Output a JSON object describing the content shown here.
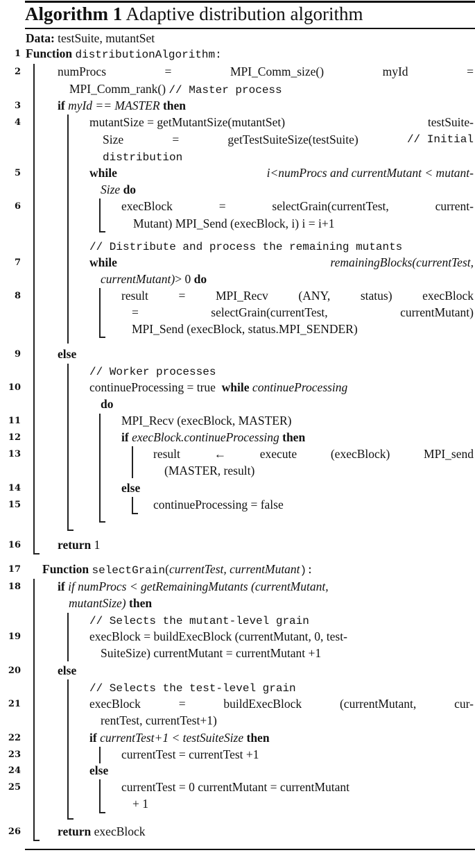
{
  "algorithm": {
    "label": "Algorithm 1",
    "caption": "Adaptive distribution algorithm",
    "data_label": "Data:",
    "data_value": "testSuite, mutantSet"
  },
  "lines": {
    "l1": {
      "num": "1",
      "kw": "Function",
      "name": "distributionAlgorithm",
      "colon": ":"
    },
    "l2": {
      "num": "2",
      "a": "numProcs",
      "b": "=",
      "c": "MPI_Comm_size()",
      "d": "myId",
      "e": "=",
      "cont": "MPI_Comm_rank()",
      "comment": "// Master process"
    },
    "l3": {
      "num": "3",
      "kw": "if",
      "cond": "myId == MASTER",
      "then": "then"
    },
    "l4": {
      "num": "4",
      "a": "mutantSize = getMutantSize(mutantSet)",
      "b": "testSuite-",
      "c": "Size",
      "d": "=",
      "e": "getTestSuiteSize(testSuite)",
      "comment": "// Initial",
      "comment2": "distribution"
    },
    "l5": {
      "num": "5",
      "kw": "while",
      "cond": "i<numProcs and currentMutant < mutant-",
      "cond2": "Size",
      "do": "do"
    },
    "l6": {
      "num": "6",
      "a": "execBlock",
      "b": "=",
      "c": "selectGrain(currentTest,",
      "d": "current-",
      "cont": "Mutant)  MPI_Send (execBlock, i)  i = i+1"
    },
    "c1": {
      "comment": "// Distribute and process the remaining mutants"
    },
    "l7": {
      "num": "7",
      "kw": "while",
      "cond": "remainingBlocks(currentTest,",
      "cond2": "currentMutant)",
      "gt": "> 0",
      "do": "do"
    },
    "l8": {
      "num": "8",
      "a": "result",
      "b": "=",
      "c": "MPI_Recv",
      "d": "(ANY,",
      "e": "status)",
      "f": "execBlock",
      "g": "=",
      "h": "selectGrain(currentTest,",
      "i": "currentMutant)",
      "cont": "MPI_Send (execBlock, status.MPI_SENDER)"
    },
    "l9": {
      "num": "9",
      "kw": "else"
    },
    "c2": {
      "comment": "// Worker processes"
    },
    "l10": {
      "num": "10",
      "a": "continueProcessing = true",
      "kw": "while",
      "cond": "continueProcessing",
      "do": "do"
    },
    "l11": {
      "num": "11",
      "text": "MPI_Recv (execBlock, MASTER)"
    },
    "l12": {
      "num": "12",
      "kw": "if",
      "cond": "execBlock.continueProcessing",
      "then": "then"
    },
    "l13": {
      "num": "13",
      "a": "result",
      "b": "←",
      "c": "execute",
      "d": "(execBlock)",
      "e": "MPI_send",
      "cont": "(MASTER, result)"
    },
    "l14": {
      "num": "14",
      "kw": "else"
    },
    "l15": {
      "num": "15",
      "text": "continueProcessing = false"
    },
    "l16": {
      "num": "16",
      "kw": "return",
      "val": "1"
    },
    "l17": {
      "num": "17",
      "kw": "Function",
      "name": "selectGrain",
      "args": "currentTest, currentMutant",
      "open": "(",
      "close": "):"
    },
    "l18": {
      "num": "18",
      "kw": "if",
      "cond": "if numProcs < getRemainingMutants (currentMutant,",
      "cond2": "mutantSize)",
      "then": "then"
    },
    "c3": {
      "comment": "// Selects the mutant-level grain"
    },
    "l19": {
      "num": "19",
      "text": "execBlock = buildExecBlock (currentMutant, 0, test-",
      "cont": "SuiteSize)  currentMutant = currentMutant +1"
    },
    "l20": {
      "num": "20",
      "kw": "else"
    },
    "c4": {
      "comment": "// Selects the test-level grain"
    },
    "l21": {
      "num": "21",
      "a": "execBlock",
      "b": "=",
      "c": "buildExecBlock",
      "d": "(currentMutant,",
      "e": "cur-",
      "cont": "rentTest, currentTest+1)"
    },
    "l22": {
      "num": "22",
      "kw": "if",
      "cond": "currentTest+1 < testSuiteSize",
      "then": "then"
    },
    "l23": {
      "num": "23",
      "text": "currentTest = currentTest +1"
    },
    "l24": {
      "num": "24",
      "kw": "else"
    },
    "l25": {
      "num": "25",
      "text": "currentTest = 0  currentMutant = currentMutant",
      "cont": "+ 1"
    },
    "l26": {
      "num": "26",
      "kw": "return",
      "val": "execBlock"
    }
  }
}
